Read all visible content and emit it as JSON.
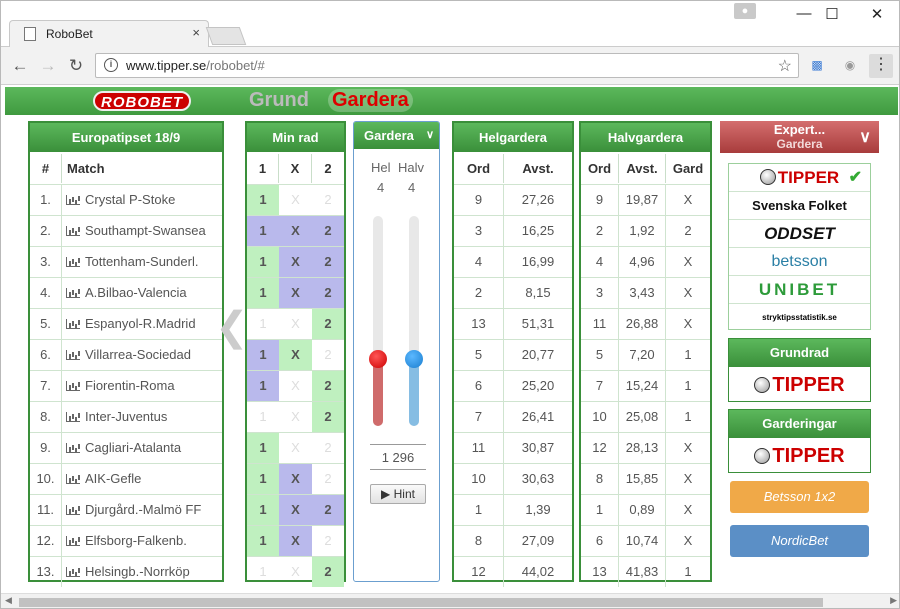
{
  "browser": {
    "tab_title": "RoboBet",
    "url_host": "www.tipper.se",
    "url_path": "/robobet/#",
    "tab_close": "×",
    "minimize": "—",
    "maximize": "☐",
    "close": "✕",
    "back": "←",
    "forward": "→",
    "reload": "↻",
    "star": "☆",
    "menu": "⋮"
  },
  "site": {
    "logo": "ROBOBET",
    "nav_grund": "Grund",
    "nav_gardera": "Gardera"
  },
  "matches_panel": {
    "title": "Europatipset 18/9",
    "col_num": "#",
    "col_match": "Match",
    "rows": [
      {
        "n": "1.",
        "match": "Crystal P-Stoke"
      },
      {
        "n": "2.",
        "match": "Southampt-Swansea"
      },
      {
        "n": "3.",
        "match": "Tottenham-Sunderl."
      },
      {
        "n": "4.",
        "match": "A.Bilbao-Valencia"
      },
      {
        "n": "5.",
        "match": "Espanyol-R.Madrid"
      },
      {
        "n": "6.",
        "match": "Villarrea-Sociedad"
      },
      {
        "n": "7.",
        "match": "Fiorentin-Roma"
      },
      {
        "n": "8.",
        "match": "Inter-Juventus"
      },
      {
        "n": "9.",
        "match": "Cagliari-Atalanta"
      },
      {
        "n": "10.",
        "match": "AIK-Gefle"
      },
      {
        "n": "11.",
        "match": "Djurgård.-Malmö FF"
      },
      {
        "n": "12.",
        "match": "Elfsborg-Falkenb."
      },
      {
        "n": "13.",
        "match": "Helsingb.-Norrköp"
      }
    ]
  },
  "minrad_panel": {
    "title": "Min rad",
    "col1": "1",
    "colX": "X",
    "col2": "2",
    "rows": [
      {
        "p1": "1",
        "pX": "X",
        "p2": "2",
        "s1": "on1",
        "sX": "off",
        "s2": "off"
      },
      {
        "p1": "1",
        "pX": "X",
        "p2": "2",
        "s1": "onX",
        "sX": "onX",
        "s2": "onX"
      },
      {
        "p1": "1",
        "pX": "X",
        "p2": "2",
        "s1": "on1",
        "sX": "onX",
        "s2": "onX"
      },
      {
        "p1": "1",
        "pX": "X",
        "p2": "2",
        "s1": "on1",
        "sX": "onX",
        "s2": "onX"
      },
      {
        "p1": "1",
        "pX": "X",
        "p2": "2",
        "s1": "off",
        "sX": "off",
        "s2": "on2"
      },
      {
        "p1": "1",
        "pX": "X",
        "p2": "2",
        "s1": "onX",
        "sX": "on1",
        "s2": "off"
      },
      {
        "p1": "1",
        "pX": "X",
        "p2": "2",
        "s1": "onX",
        "sX": "off",
        "s2": "on2"
      },
      {
        "p1": "1",
        "pX": "X",
        "p2": "2",
        "s1": "off",
        "sX": "off",
        "s2": "on2"
      },
      {
        "p1": "1",
        "pX": "X",
        "p2": "2",
        "s1": "on1",
        "sX": "off",
        "s2": "off"
      },
      {
        "p1": "1",
        "pX": "X",
        "p2": "2",
        "s1": "on1",
        "sX": "onX",
        "s2": "off"
      },
      {
        "p1": "1",
        "pX": "X",
        "p2": "2",
        "s1": "on1",
        "sX": "onX",
        "s2": "onX"
      },
      {
        "p1": "1",
        "pX": "X",
        "p2": "2",
        "s1": "on1",
        "sX": "onX",
        "s2": "off"
      },
      {
        "p1": "1",
        "pX": "X",
        "p2": "2",
        "s1": "off",
        "sX": "off",
        "s2": "on2"
      }
    ]
  },
  "gardera_panel": {
    "title": "Gardera",
    "hel_label": "Hel",
    "halv_label": "Halv",
    "hel_value": "4",
    "halv_value": "4",
    "hel_level": 0.32,
    "halv_level": 0.32,
    "row_count": "1 296",
    "hint": "▶ Hint"
  },
  "helgardera_panel": {
    "title": "Helgardera",
    "col_ord": "Ord",
    "col_avst": "Avst.",
    "rows": [
      {
        "ord": "9",
        "avst": "27,26"
      },
      {
        "ord": "3",
        "avst": "16,25"
      },
      {
        "ord": "4",
        "avst": "16,99"
      },
      {
        "ord": "2",
        "avst": "8,15"
      },
      {
        "ord": "13",
        "avst": "51,31"
      },
      {
        "ord": "5",
        "avst": "20,77"
      },
      {
        "ord": "6",
        "avst": "25,20"
      },
      {
        "ord": "7",
        "avst": "26,41"
      },
      {
        "ord": "11",
        "avst": "30,87"
      },
      {
        "ord": "10",
        "avst": "30,63"
      },
      {
        "ord": "1",
        "avst": "1,39"
      },
      {
        "ord": "8",
        "avst": "27,09"
      },
      {
        "ord": "12",
        "avst": "44,02"
      }
    ]
  },
  "halvgardera_panel": {
    "title": "Halvgardera",
    "col_ord": "Ord",
    "col_avst": "Avst.",
    "col_gard": "Gard",
    "rows": [
      {
        "ord": "9",
        "avst": "19,87",
        "gard": "X"
      },
      {
        "ord": "2",
        "avst": "1,92",
        "gard": "2"
      },
      {
        "ord": "4",
        "avst": "4,96",
        "gard": "X"
      },
      {
        "ord": "3",
        "avst": "3,43",
        "gard": "X"
      },
      {
        "ord": "11",
        "avst": "26,88",
        "gard": "X"
      },
      {
        "ord": "5",
        "avst": "7,20",
        "gard": "1"
      },
      {
        "ord": "7",
        "avst": "15,24",
        "gard": "1"
      },
      {
        "ord": "10",
        "avst": "25,08",
        "gard": "1"
      },
      {
        "ord": "12",
        "avst": "28,13",
        "gard": "X"
      },
      {
        "ord": "8",
        "avst": "15,85",
        "gard": "X"
      },
      {
        "ord": "1",
        "avst": "0,89",
        "gard": "X"
      },
      {
        "ord": "6",
        "avst": "10,74",
        "gard": "X"
      },
      {
        "ord": "13",
        "avst": "41,83",
        "gard": "1"
      }
    ]
  },
  "sidebar": {
    "expert_line1": "Expert...",
    "expert_line2": "Gardera",
    "bookies": {
      "tipper": "TIPPER",
      "svenska_folket": "Svenska Folket",
      "oddset": "ODDSET",
      "betsson": "betsson",
      "unibet": "UNIBET",
      "strykta": "stryktipsstatistik.se"
    },
    "grundrad_title": "Grundrad",
    "grundrad_logo": "TIPPER",
    "garderingar_title": "Garderingar",
    "garderingar_logo": "TIPPER",
    "betsson_btn": "Betsson 1x2",
    "nordicbet_btn": "NordicBet"
  },
  "colors": {
    "green": "#3a8f3a",
    "red": "#cc0000",
    "betsson_orange": "#f0a948",
    "nordicbet_blue": "#5b8fc6"
  }
}
